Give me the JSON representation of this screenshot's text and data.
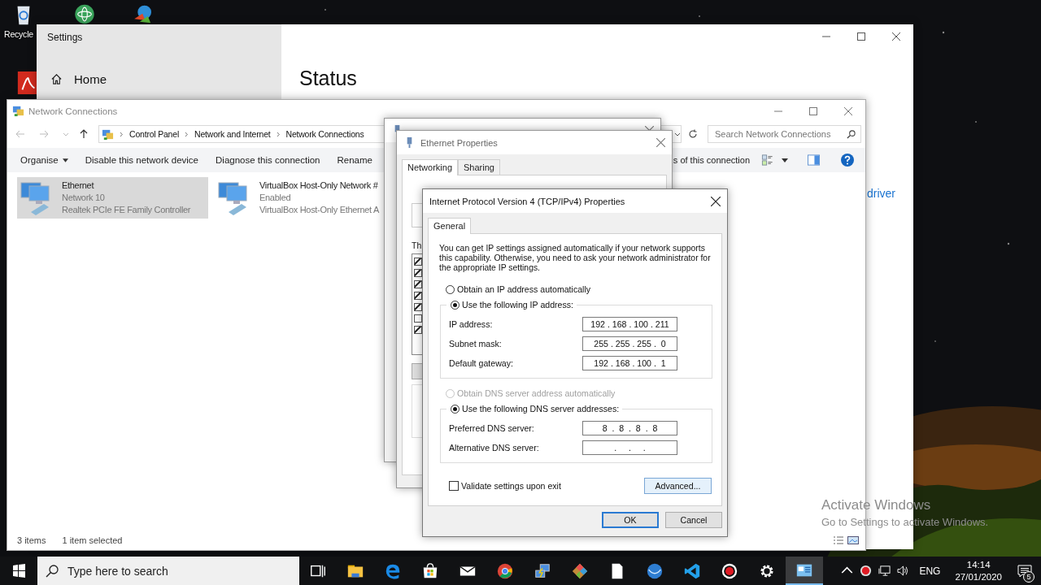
{
  "desktop": {
    "icons": [
      {
        "label": "Recycle",
        "kind": "recycle"
      },
      {
        "kind": "atom"
      },
      {
        "kind": "globe"
      },
      {
        "kind": "pdf"
      }
    ]
  },
  "settings_window": {
    "title": "Settings",
    "nav": [
      {
        "label": "Home",
        "selected": false
      }
    ],
    "heading": "Status",
    "link": "driver"
  },
  "network_connections": {
    "title": "Network Connections",
    "breadcrumb": [
      "Control Panel",
      "Network and Internet",
      "Network Connections"
    ],
    "search_placeholder": "Search Network Connections",
    "toolbar": [
      {
        "label": "Organise",
        "kind": "menu"
      },
      {
        "label": "Disable this network device",
        "kind": "button"
      },
      {
        "label": "Diagnose this connection",
        "kind": "button"
      },
      {
        "label": "Rename",
        "kind": "button"
      }
    ],
    "toolbar_fragment": "s of this connection",
    "items": [
      {
        "name": "Ethernet",
        "status": "Network 10",
        "device": "Realtek PCIe FE Family Controller",
        "selected": true
      },
      {
        "name": "VirtualBox Host-Only Network #",
        "status": "Enabled",
        "device": "VirtualBox Host-Only Ethernet A",
        "selected": false
      }
    ],
    "status_bar": [
      "3 items",
      "1 item selected"
    ]
  },
  "ethernet_properties": {
    "title": "Ethernet Properties",
    "tabs": [
      {
        "label": "Networking",
        "selected": true
      },
      {
        "label": "Sharing",
        "selected": false
      }
    ],
    "fragment": "Th",
    "components": [
      {
        "checked": true
      },
      {
        "checked": true
      },
      {
        "checked": true
      },
      {
        "checked": true
      },
      {
        "checked": true
      },
      {
        "checked": false
      },
      {
        "checked": true
      }
    ]
  },
  "ipv4_properties": {
    "title": "Internet Protocol Version 4 (TCP/IPv4) Properties",
    "tabs": [
      {
        "label": "General",
        "selected": true
      }
    ],
    "intro": "You can get IP settings assigned automatically if your network supports this capability. Otherwise, you need to ask your network administrator for the appropriate IP settings.",
    "ip_mode": [
      {
        "label": "Obtain an IP address automatically",
        "selected": false,
        "disabled": false
      },
      {
        "label": "Use the following IP address:",
        "selected": true,
        "disabled": false
      }
    ],
    "ip_fields": [
      {
        "label": "IP address:",
        "value": "192 . 168 . 100 . 211"
      },
      {
        "label": "Subnet mask:",
        "value": "255 . 255 . 255 .  0"
      },
      {
        "label": "Default gateway:",
        "value": "192 . 168 . 100 .  1"
      }
    ],
    "dns_mode": [
      {
        "label": "Obtain DNS server address automatically",
        "selected": false,
        "disabled": true
      },
      {
        "label": "Use the following DNS server addresses:",
        "selected": true,
        "disabled": false
      }
    ],
    "dns_fields": [
      {
        "label": "Preferred DNS server:",
        "value": "8  .  8  .  8  .  8"
      },
      {
        "label": "Alternative DNS server:",
        "value": ".     .     ."
      }
    ],
    "validate": {
      "label": "Validate settings upon exit",
      "checked": false
    },
    "buttons": [
      {
        "label": "Advanced...",
        "kind": "advanced"
      },
      {
        "label": "OK",
        "kind": "default"
      },
      {
        "label": "Cancel",
        "kind": "normal"
      }
    ]
  },
  "activation_notice": {
    "title": "Activate Windows",
    "message": "Go to Settings to activate Windows."
  },
  "taskbar": {
    "search_placeholder": "Type here to search",
    "apps": [
      {
        "kind": "taskview",
        "selected": false
      },
      {
        "kind": "folder",
        "selected": false
      },
      {
        "kind": "edge",
        "selected": false
      },
      {
        "kind": "store",
        "selected": false
      },
      {
        "kind": "mail",
        "selected": false
      },
      {
        "kind": "chrome",
        "selected": false
      },
      {
        "kind": "network",
        "selected": false
      },
      {
        "kind": "diamond",
        "selected": false
      },
      {
        "kind": "document",
        "selected": false
      },
      {
        "kind": "sphere",
        "selected": false
      },
      {
        "kind": "vscode",
        "selected": false
      },
      {
        "kind": "record",
        "selected": false
      },
      {
        "kind": "gear",
        "selected": false
      },
      {
        "kind": "control",
        "selected": true
      }
    ],
    "language": "ENG",
    "time": "14:14",
    "date": "27/01/2020",
    "notifications": "5"
  }
}
